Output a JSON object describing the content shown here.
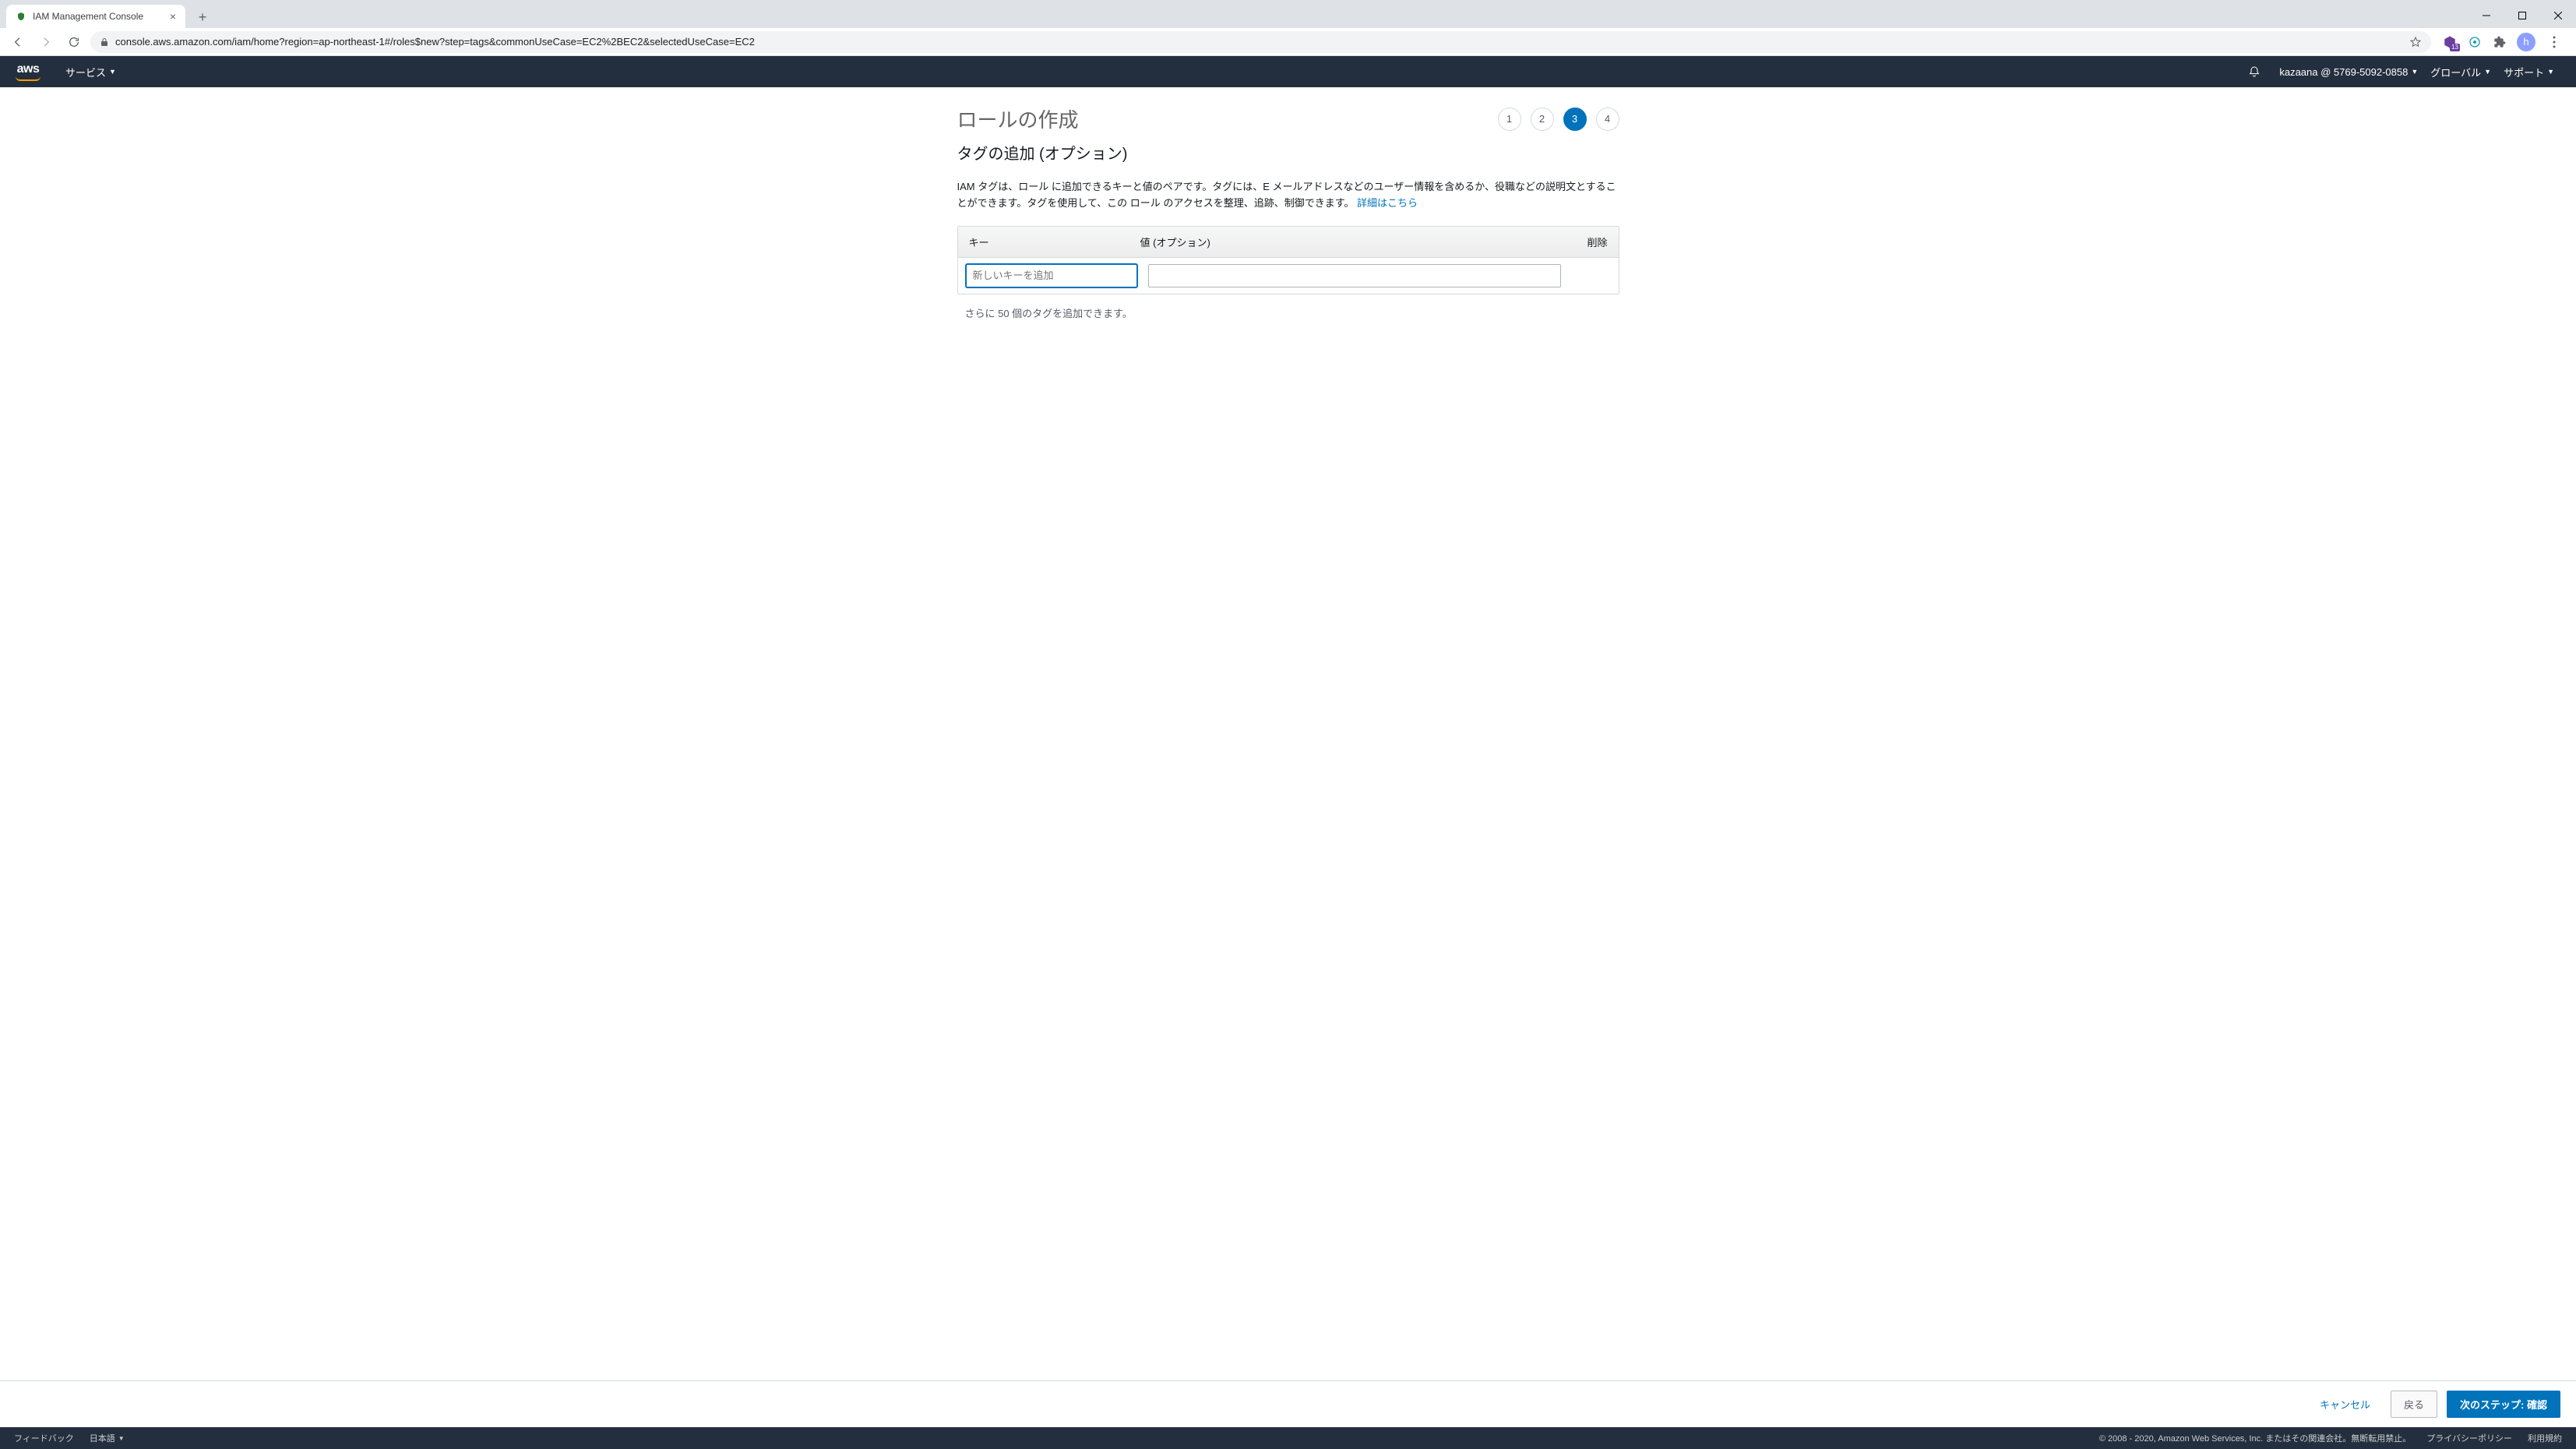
{
  "browser": {
    "tab_title": "IAM Management Console",
    "url": "console.aws.amazon.com/iam/home?region=ap-northeast-1#/roles$new?step=tags&commonUseCase=EC2%2BEC2&selectedUseCase=EC2",
    "ext_badge": "13",
    "avatar_initial": "h"
  },
  "aws_header": {
    "services": "サービス",
    "account": "kazaana @ 5769-5092-0858",
    "region": "グローバル",
    "support": "サポート"
  },
  "main": {
    "page_title": "ロールの作成",
    "steps": [
      "1",
      "2",
      "3",
      "4"
    ],
    "active_step": 3,
    "subtitle": "タグの追加 (オプション)",
    "description_prefix": "IAM タグは、ロール に追加できるキーと値のペアです。タグには、E メールアドレスなどのユーザー情報を含めるか、役職などの説明文とすることができます。タグを使用して、この ロール のアクセスを整理、追跡、制御できます。 ",
    "description_link": "詳細はこちら",
    "table": {
      "col_key": "キー",
      "col_value": "値 (オプション)",
      "col_delete": "削除",
      "key_placeholder": "新しいキーを追加",
      "key_value": "",
      "value_value": ""
    },
    "remaining": "さらに 50 個のタグを追加できます。"
  },
  "actions": {
    "cancel": "キャンセル",
    "back": "戻る",
    "next": "次のステップ: 確認"
  },
  "footer": {
    "feedback": "フィードバック",
    "language": "日本語",
    "copyright": "© 2008 - 2020, Amazon Web Services, Inc. またはその関連会社。無断転用禁止。",
    "privacy": "プライバシーポリシー",
    "terms": "利用規約"
  }
}
